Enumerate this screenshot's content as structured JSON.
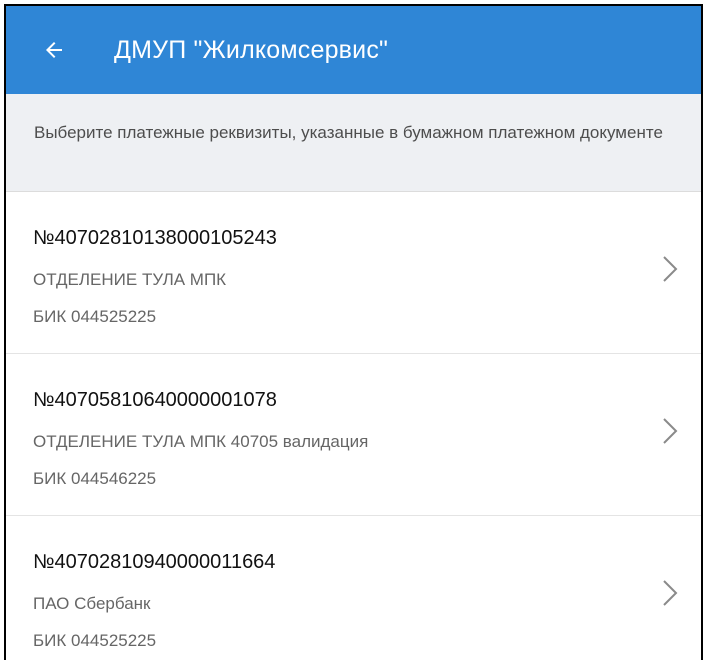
{
  "header": {
    "title": "ДМУП \"Жилкомсервис\"",
    "back_icon": "arrow-left-icon",
    "color": "#2f86d6"
  },
  "hint": {
    "text": "Выберите платежные реквизиты, указанные в бумажном платежном документе"
  },
  "accounts": [
    {
      "number": "№40702810138000105243",
      "bank": "ОТДЕЛЕНИЕ ТУЛА  МПК",
      "bik": "БИК 044525225"
    },
    {
      "number": "№40705810640000001078",
      "bank": "ОТДЕЛЕНИЕ ТУЛА  МПК 40705 валидация",
      "bik": "БИК 044546225"
    },
    {
      "number": "№40702810940000011664",
      "bank": "ПАО Сбербанк",
      "bik": "БИК 044525225"
    }
  ]
}
